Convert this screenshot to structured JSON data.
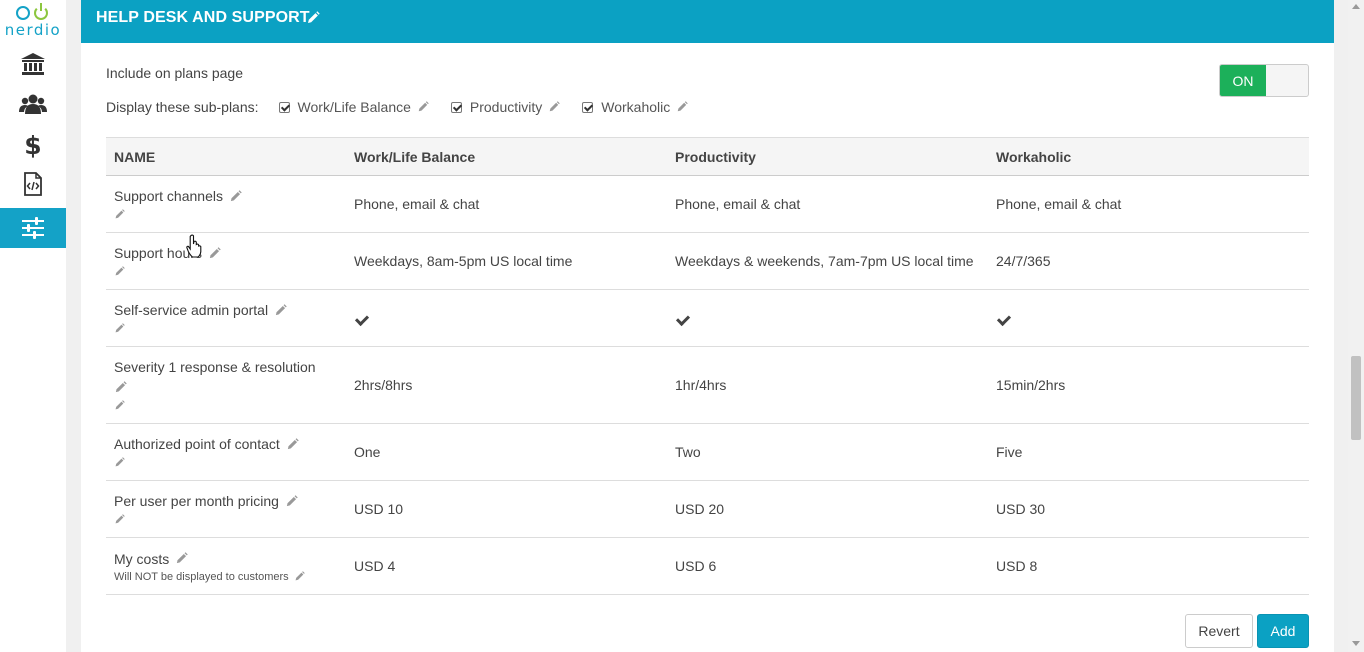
{
  "logo": {
    "text": "nerdio"
  },
  "sidebar": {
    "items": [
      {
        "name": "bank-icon"
      },
      {
        "name": "users-icon"
      },
      {
        "name": "dollar-icon"
      },
      {
        "name": "code-file-icon"
      },
      {
        "name": "sliders-icon",
        "active": true
      }
    ]
  },
  "header": {
    "title": "HELP DESK AND SUPPORT"
  },
  "include": {
    "label": "Include on plans page",
    "toggle": "ON"
  },
  "subplans": {
    "label": "Display these sub-plans:",
    "items": [
      "Work/Life Balance",
      "Productivity",
      "Workaholic"
    ]
  },
  "table": {
    "headers": [
      "NAME",
      "Work/Life Balance",
      "Productivity",
      "Workaholic"
    ],
    "rows": [
      {
        "name": "Support channels",
        "a": "Phone, email & chat",
        "b": "Phone, email & chat",
        "c": "Phone, email & chat"
      },
      {
        "name": "Support hours",
        "a": "Weekdays, 8am-5pm US local time",
        "b": "Weekdays & weekends, 7am-7pm US local time",
        "c": "24/7/365"
      },
      {
        "name": "Self-service admin portal",
        "a": "",
        "b": "",
        "c": ""
      },
      {
        "name": "Severity 1 response & resolution",
        "a": "2hrs/8hrs",
        "b": "1hr/4hrs",
        "c": "15min/2hrs"
      },
      {
        "name": "Authorized point of contact",
        "a": "One",
        "b": "Two",
        "c": "Five"
      },
      {
        "name": "Per user per month pricing",
        "a": "USD 10",
        "b": "USD 20",
        "c": "USD 30"
      },
      {
        "name": "My costs",
        "note": "Will NOT be displayed to customers",
        "a": "USD 4",
        "b": "USD 6",
        "c": "USD 8"
      }
    ]
  },
  "buttons": {
    "revert": "Revert",
    "add": "Add"
  },
  "colors": {
    "accent": "#0ba1c3",
    "toggle_on": "#1cb05a"
  }
}
